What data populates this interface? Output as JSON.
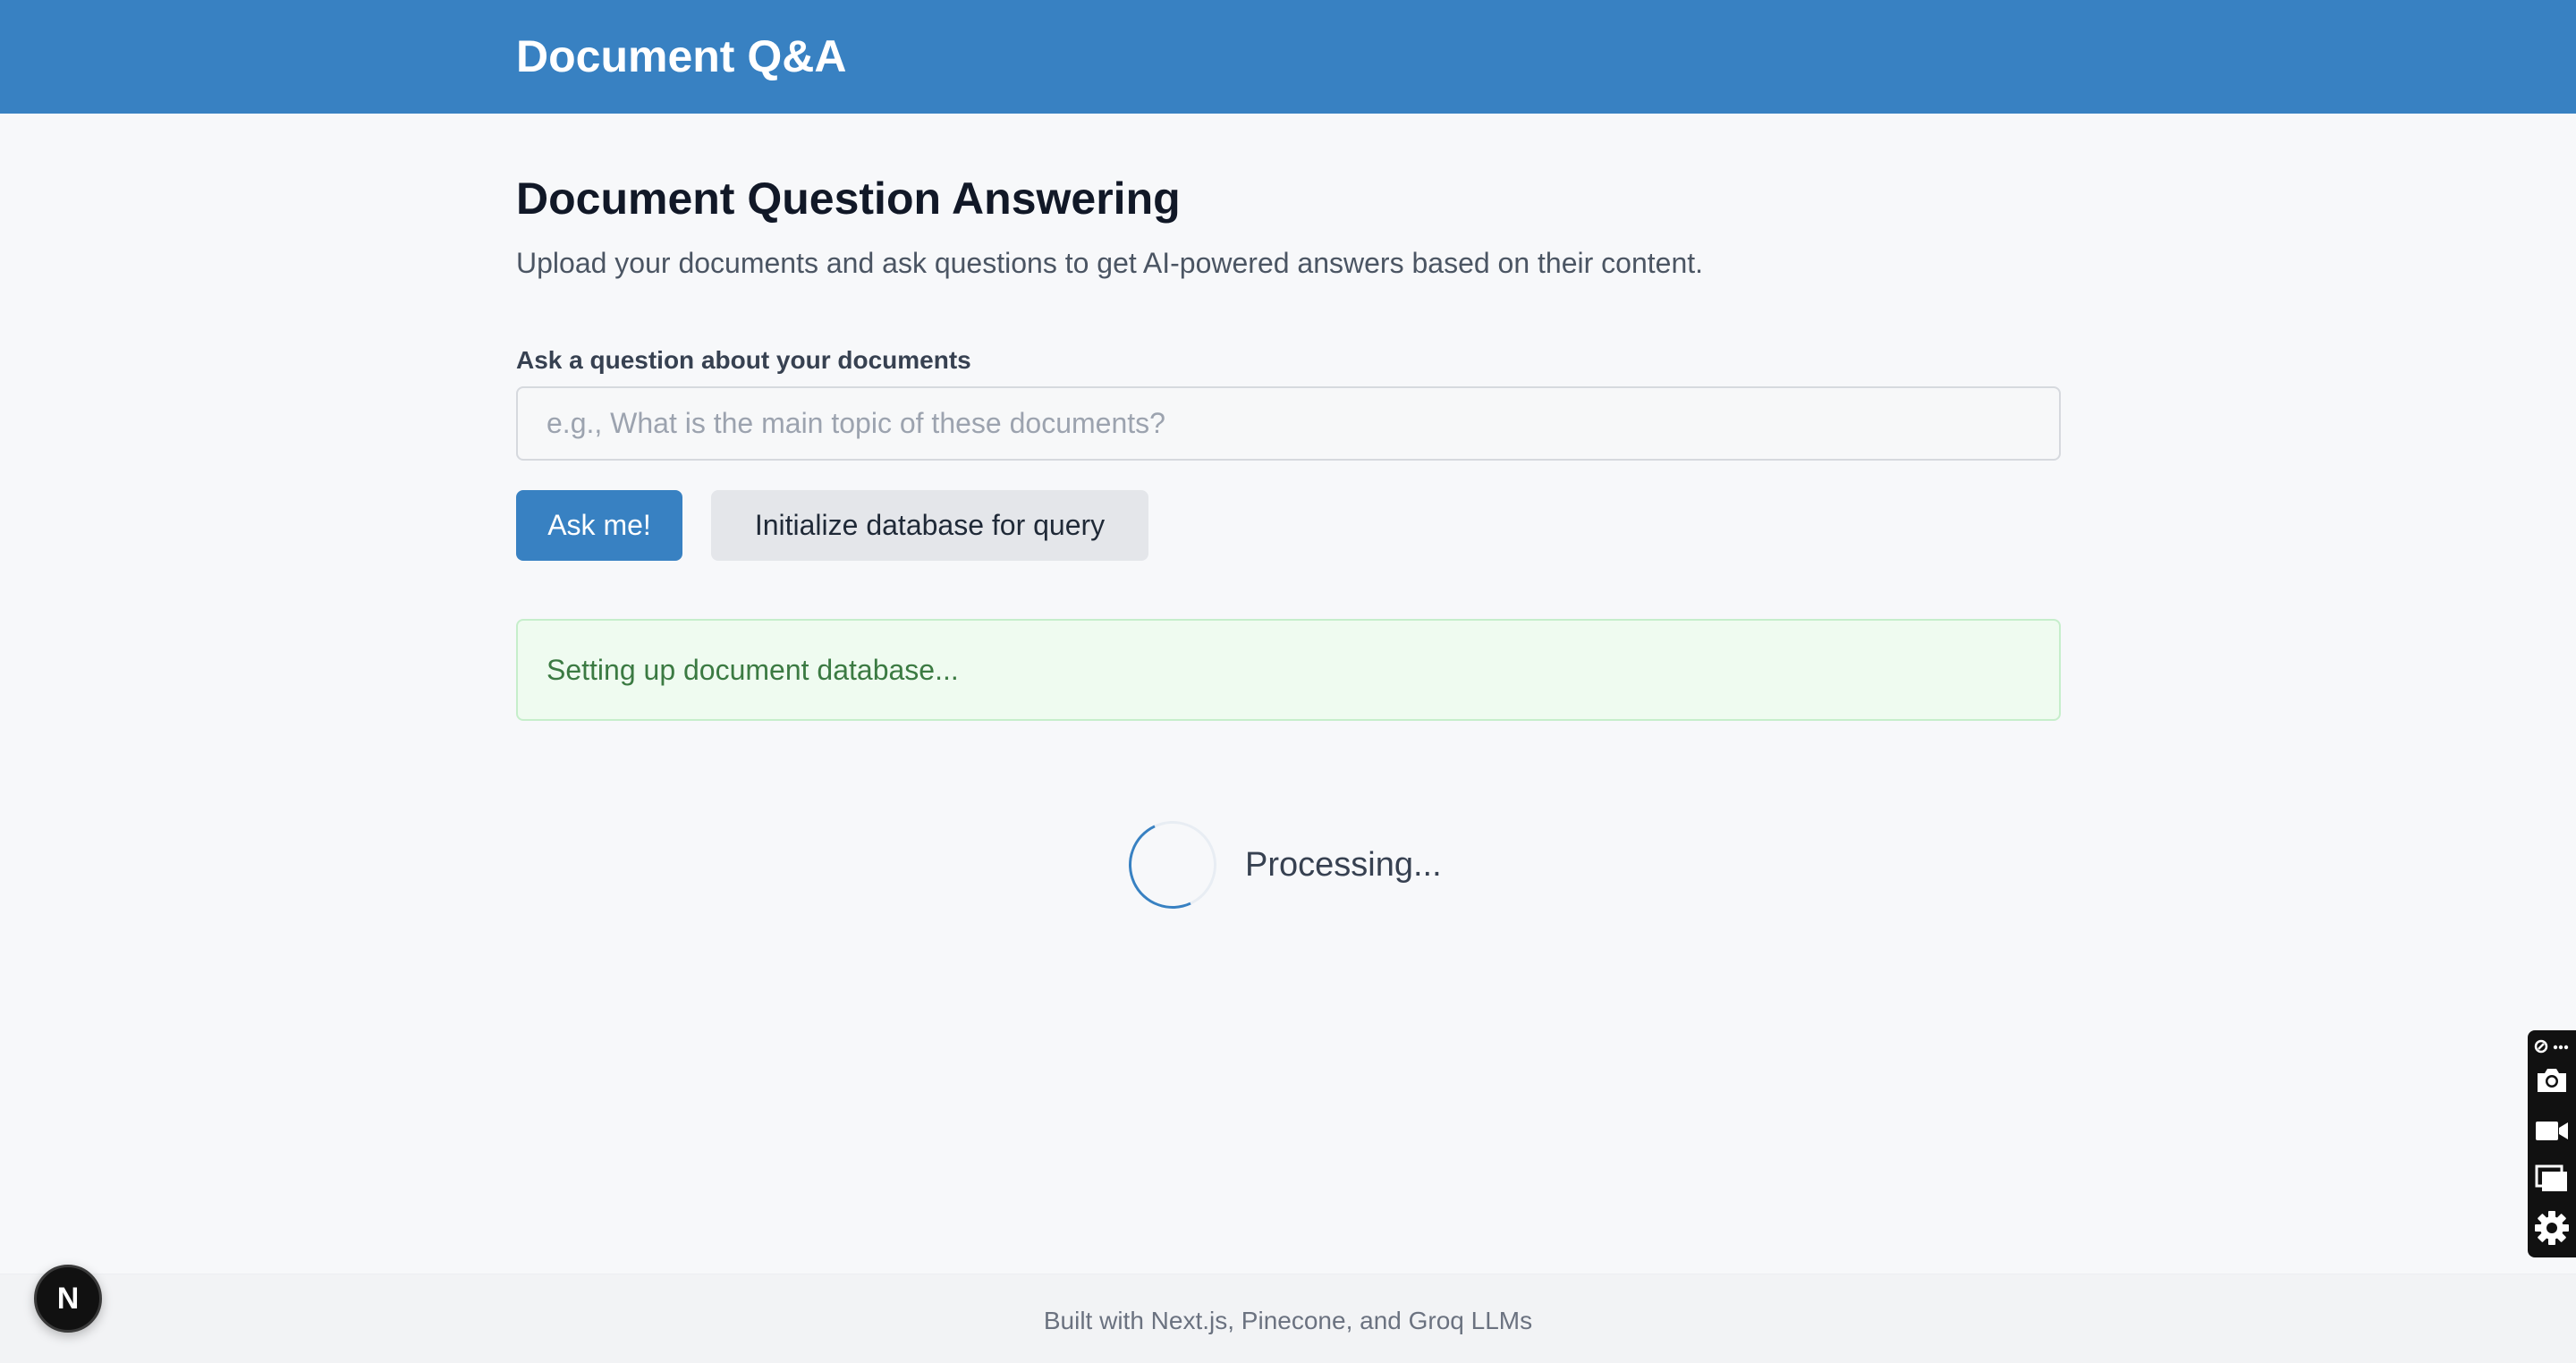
{
  "header": {
    "title": "Document Q&A"
  },
  "main": {
    "title": "Document Question Answering",
    "subtitle": "Upload your documents and ask questions to get AI-powered answers based on their content.",
    "question_label": "Ask a question about your documents",
    "question_value": "",
    "question_placeholder": "e.g., What is the main topic of these documents?",
    "ask_button": "Ask me!",
    "init_button": "Initialize database for query",
    "status_message": "Setting up document database...",
    "processing_text": "Processing..."
  },
  "footer": {
    "text": "Built with Next.js, Pinecone, and Groq LLMs"
  },
  "dev_badge": {
    "letter": "N"
  },
  "colors": {
    "header_bg": "#3881c2",
    "primary_button": "#3881c2",
    "status_bg": "#effbf0",
    "status_text": "#3b7a42"
  },
  "side_toolbar": {
    "icons": [
      "link-more-icon",
      "camera-icon",
      "video-icon",
      "windows-icon",
      "gear-icon"
    ]
  }
}
